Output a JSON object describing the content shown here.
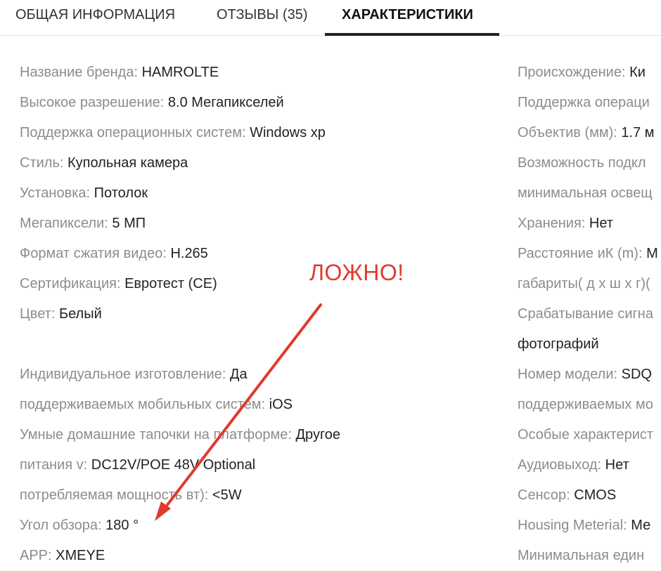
{
  "tabs": [
    {
      "label": "ОБЩАЯ ИНФОРМАЦИЯ",
      "active": false
    },
    {
      "label": "ОТЗЫВЫ (35)",
      "active": false
    },
    {
      "label": "ХАРАКТЕРИСТИКИ",
      "active": true
    }
  ],
  "left_specs": [
    {
      "name": "Название бренда: ",
      "value": "HAMROLTE"
    },
    {
      "name": "Высокое разрешение: ",
      "value": "8.0 Мегапикселей"
    },
    {
      "name": "Поддержка операционных систем: ",
      "value": "Windows xp"
    },
    {
      "name": "Стиль: ",
      "value": "Купольная камера"
    },
    {
      "name": "Установка: ",
      "value": "Потолок"
    },
    {
      "name": "Мегапиксели: ",
      "value": "5 МП"
    },
    {
      "name": "Формат сжатия видео: ",
      "value": "H.265"
    },
    {
      "name": "Сертификация: ",
      "value": "Евротест (CE)"
    },
    {
      "name": "Цвет: ",
      "value": "Белый"
    },
    {
      "name": "Индивидуальное изготовление: ",
      "value": "Да"
    },
    {
      "name": "поддерживаемых мобильных систем: ",
      "value": "iOS"
    },
    {
      "name": "Умные домашние тапочки на платформе: ",
      "value": "Другое"
    },
    {
      "name": "питания v: ",
      "value": "DC12V/POE 48V Optional"
    },
    {
      "name": "потребляемая мощность вт): ",
      "value": "<5W"
    },
    {
      "name": "Угол обзора: ",
      "value": "180 °"
    },
    {
      "name": "APP: ",
      "value": "XMEYE"
    }
  ],
  "right_specs": [
    {
      "name": "Происхождение: ",
      "value": "Ки"
    },
    {
      "name": "Поддержка операци",
      "value": ""
    },
    {
      "name": "Объектив (мм): ",
      "value": "1.7 м"
    },
    {
      "name": "Возможность подкл",
      "value": ""
    },
    {
      "name": "минимальная освещ",
      "value": ""
    },
    {
      "name": "Хранения: ",
      "value": "Нет"
    },
    {
      "name": "Расстояние иК (m): ",
      "value": "M"
    },
    {
      "name": "габариты( д х ш х г)(",
      "value": ""
    },
    {
      "name": "Срабатывание сигна",
      "value": ""
    },
    {
      "name": "",
      "value": "фотографий"
    },
    {
      "name": "Номер модели: ",
      "value": "SDQ"
    },
    {
      "name": "поддерживаемых мо",
      "value": ""
    },
    {
      "name": "Особые характерист",
      "value": ""
    },
    {
      "name": "Аудиовыход: ",
      "value": "Нет"
    },
    {
      "name": "Сенсор: ",
      "value": "CMOS"
    },
    {
      "name": "Housing Meterial: ",
      "value": "Ме"
    },
    {
      "name": "Минимальная един",
      "value": ""
    }
  ],
  "annotation": {
    "text": "ЛОЖНО!",
    "color": "#e03a2e"
  }
}
